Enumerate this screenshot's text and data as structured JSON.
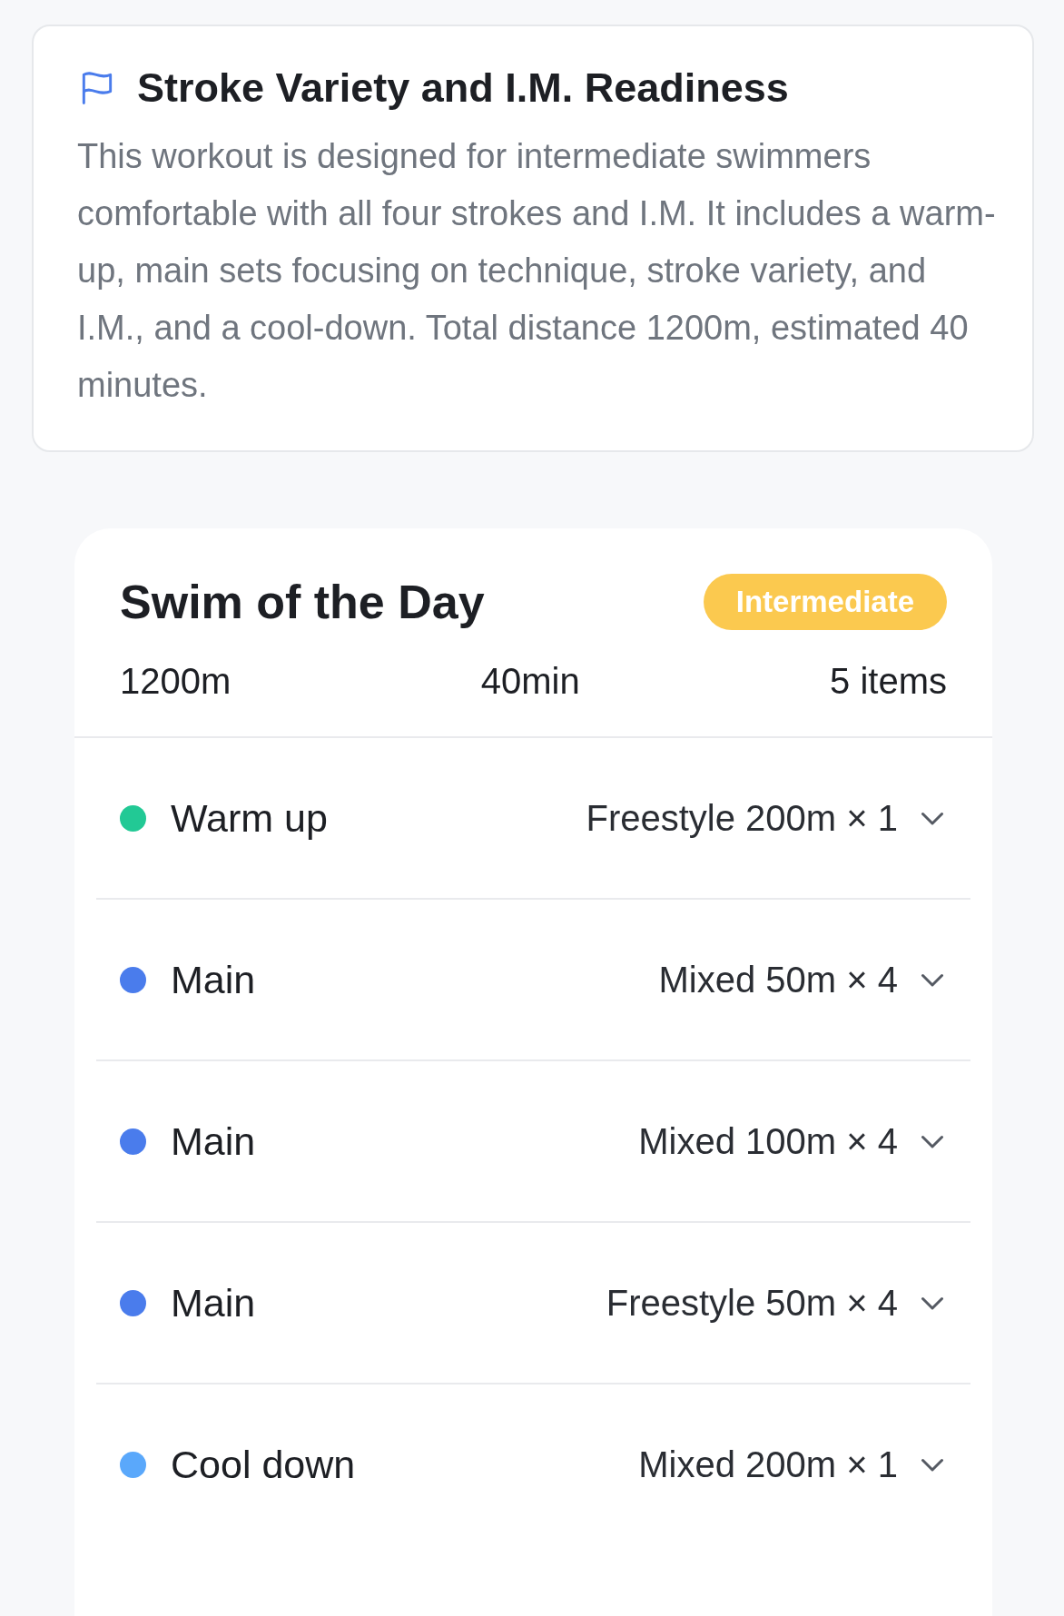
{
  "summary": {
    "title": "Stroke Variety and I.M. Readiness",
    "description": "This workout is designed for intermediate swimmers comfortable with all four strokes and I.M. It includes a warm-up, main sets focusing on technique, stroke variety, and I.M., and a cool-down. Total distance 1200m, estimated 40 minutes."
  },
  "workout": {
    "title": "Swim of the Day",
    "difficulty": "Intermediate",
    "stats": [
      "1200m",
      "40min",
      "5 items"
    ],
    "sets": [
      {
        "name": "Warm up",
        "detail": "Freestyle 200m × 1",
        "color": "#22c995",
        "expanded": false
      },
      {
        "name": "Main",
        "detail": "Mixed 50m × 4",
        "color": "#4a7cec",
        "expanded": false
      },
      {
        "name": "Main",
        "detail": "Mixed 100m × 4",
        "color": "#4a7cec",
        "expanded": false
      },
      {
        "name": "Main",
        "detail": "Freestyle 50m × 4",
        "color": "#4a7cec",
        "expanded": false
      },
      {
        "name": "Cool down",
        "detail": "Mixed 200m × 1",
        "color": "#5aa8fb",
        "expanded": false
      }
    ]
  }
}
